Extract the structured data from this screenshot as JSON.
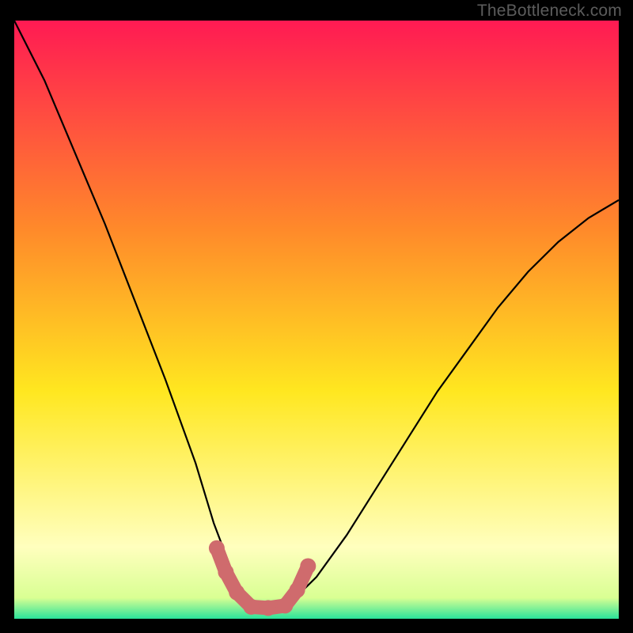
{
  "watermark": "TheBottleneck.com",
  "colors": {
    "black": "#000000",
    "grad_top": "#ff1a53",
    "grad_mid_orange": "#ff8a2a",
    "grad_yellow": "#ffe720",
    "grad_paleyellow": "#ffffbe",
    "grad_green": "#2ae29a",
    "curve": "#000000",
    "salmon_marker": "#cf6b6d",
    "watermark": "#5c5c5c"
  },
  "chart_data": {
    "type": "line",
    "title": "",
    "xlabel": "",
    "ylabel": "",
    "xlim": [
      0,
      1
    ],
    "ylim": [
      0,
      1
    ],
    "note": "Unlabeled axes; values are estimated normalized curve coordinates read from the raster.",
    "series": [
      {
        "name": "bottleneck-curve",
        "x": [
          0.0,
          0.05,
          0.1,
          0.15,
          0.2,
          0.25,
          0.3,
          0.33,
          0.36,
          0.38,
          0.4,
          0.42,
          0.44,
          0.46,
          0.5,
          0.55,
          0.6,
          0.65,
          0.7,
          0.75,
          0.8,
          0.85,
          0.9,
          0.95,
          1.0
        ],
        "y": [
          1.0,
          0.9,
          0.78,
          0.66,
          0.53,
          0.4,
          0.26,
          0.16,
          0.08,
          0.04,
          0.02,
          0.02,
          0.02,
          0.03,
          0.07,
          0.14,
          0.22,
          0.3,
          0.38,
          0.45,
          0.52,
          0.58,
          0.63,
          0.67,
          0.7
        ]
      },
      {
        "name": "highlight-markers",
        "type": "scatter",
        "x": [
          0.335,
          0.35,
          0.368,
          0.392,
          0.42,
          0.448,
          0.468,
          0.486
        ],
        "y": [
          0.118,
          0.078,
          0.044,
          0.02,
          0.018,
          0.022,
          0.048,
          0.088
        ]
      }
    ],
    "gradient_stops": [
      {
        "offset": 0.0,
        "color": "#ff1a53"
      },
      {
        "offset": 0.35,
        "color": "#ff8a2a"
      },
      {
        "offset": 0.62,
        "color": "#ffe720"
      },
      {
        "offset": 0.88,
        "color": "#ffffbe"
      },
      {
        "offset": 0.965,
        "color": "#d9ff93"
      },
      {
        "offset": 1.0,
        "color": "#2ae29a"
      }
    ]
  }
}
